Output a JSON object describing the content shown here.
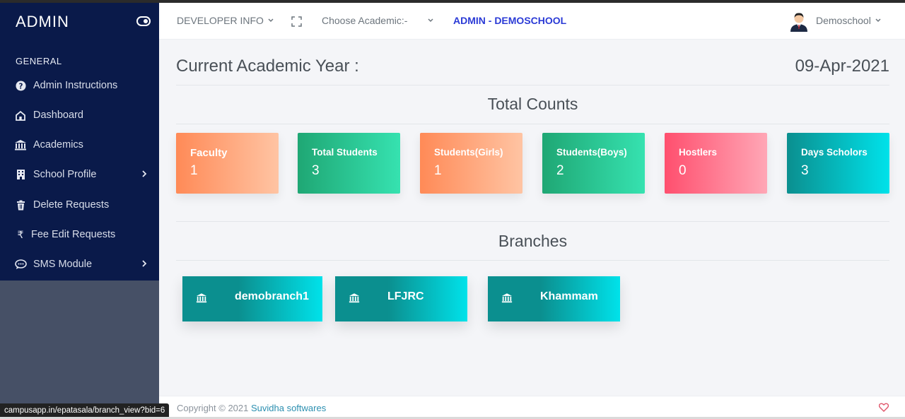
{
  "sidebar": {
    "brand": "ADMIN",
    "section_label": "GENERAL",
    "items": [
      {
        "label": "Admin Instructions",
        "icon": "question-circle-icon"
      },
      {
        "label": "Dashboard",
        "icon": "home-icon"
      },
      {
        "label": "Academics",
        "icon": "bank-icon"
      },
      {
        "label": "School Profile",
        "icon": "building-icon"
      },
      {
        "label": "Delete Requests",
        "icon": "trash-icon"
      },
      {
        "label": "Fee Edit Requests",
        "icon": "rupee-icon"
      },
      {
        "label": "SMS Module",
        "icon": "chat-icon"
      }
    ]
  },
  "header": {
    "developer_info": "DEVELOPER INFO",
    "academic_select": "Choose Academic:-",
    "title": "ADMIN - DEMOSCHOOL",
    "user": "Demoschool"
  },
  "main": {
    "academic_year_label": "Current Academic Year :",
    "date": "09-Apr-2021",
    "total_counts_heading": "Total Counts",
    "cards": [
      {
        "label": "Faculty",
        "value": "1",
        "colors": [
          "#ff8a57",
          "#ffc4a3"
        ]
      },
      {
        "label": "Total Students",
        "value": "3",
        "colors": [
          "#1fa774",
          "#36e2b0"
        ]
      },
      {
        "label": "Students(Girls)",
        "value": "1",
        "colors": [
          "#ff8a57",
          "#ffc4a3"
        ]
      },
      {
        "label": "Students(Boys)",
        "value": "2",
        "colors": [
          "#1fa774",
          "#36e2b0"
        ]
      },
      {
        "label": "Hostlers",
        "value": "0",
        "colors": [
          "#ff4f6e",
          "#ffa7b6"
        ]
      },
      {
        "label": "Days Scholors",
        "value": "3",
        "colors": [
          "#0b8f8f",
          "#00e2ea"
        ]
      }
    ],
    "branches_heading": "Branches",
    "branches": [
      {
        "name": "demobranch1"
      },
      {
        "name": "LFJRC"
      },
      {
        "name": "Khammam"
      }
    ]
  },
  "footer": {
    "copyright": "Copyright © 2021",
    "company": "Suvidha softwares"
  },
  "status_url": "campusapp.in/epatasala/branch_view?bid=6"
}
